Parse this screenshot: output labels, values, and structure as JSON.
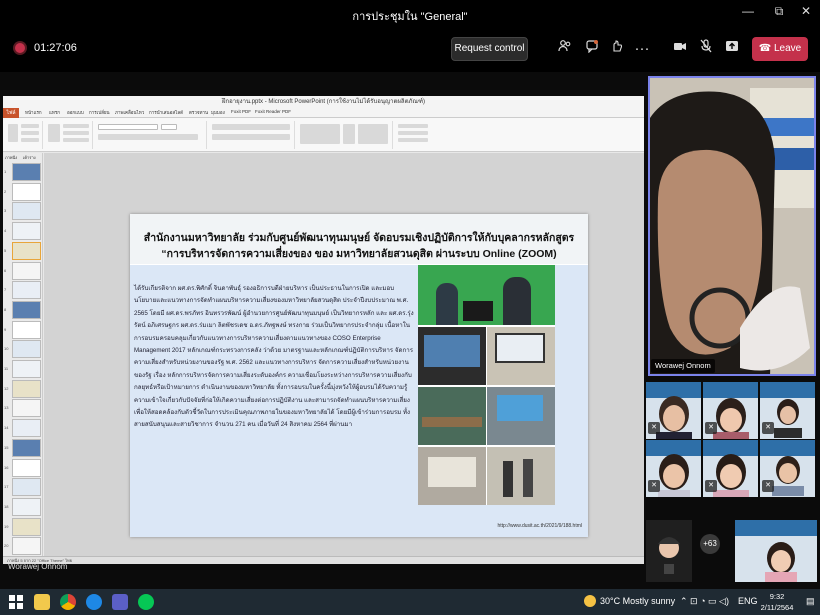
{
  "window": {
    "title": "การประชุมใน \"General\"",
    "minimize": "—",
    "maximize": "⧉",
    "close": "✕"
  },
  "toolbar": {
    "timer": "01:27:06",
    "request_control": "Request control",
    "leave": "Leave"
  },
  "presentation": {
    "app_title": "ฝึกอายุงาน.pptx - Microsoft PowerPoint (การใช้งานไม่ได้รับอนุญาตผลิตภัณฑ์)",
    "file_tab": "ไฟล์",
    "tabs": [
      "หน้าแรก",
      "แทรก",
      "ออกแบบ",
      "การเปลี่ยน",
      "ภาพเคลื่อนไหว",
      "การนำเสนอสไลด์",
      "ตรวจทาน",
      "มุมมอง",
      "Foxit PDF",
      "Foxit Reader PDF"
    ],
    "panel_tabs": [
      "ภาพนิ่ง",
      "เค้าร่าง"
    ],
    "slide_count": 22,
    "selected_slide": 5,
    "status": "ภาพนิ่ง 5 จาก 22   \"Office Theme\"   ไทย",
    "slide": {
      "title_line1": "สำนักงานมหาวิทยาลัย ร่วมกับศูนย์พัฒนาทุนมนุษย์ จัดอบรมเชิงปฏิบัติการให้กับบุคลากรหลักสูตร",
      "title_line2": "“การบริหารจัดการความเสี่ยงของ ของ มหาวิทยาลัยสวนดุสิต ผ่านระบบ Online (ZOOM)",
      "body": "ได้รับเกียรติจาก ผศ.ดร.พิศักดิ์ จินดาพันธ์ุ รองอธิการบดีฝ่ายบริหาร เป็นประธานในการเปิด และมอบนโยบายและแนวทางการจัดทำแผนบริหารความเสี่ยงของมหาวิทยาลัยสวนดุสิต ประจำปีงบประมาณ พ.ศ. 2565 โดยมี ผศ.ดร.พรภัทร อินทรวรพัฒน์ ผู้อำนวยการศูนย์พัฒนาทุนมนุษย์ เป็นวิทยากรหลัก และ ผศ.ดร.รุ่งรัตน์ อภิเศรษฐกร ผศ.ดร.ร่มเมา ลิตพัชรเดช อ.ดร.ภัทฐพงษ์ ทรงกาย ร่วมเป็นวิทยากรประจำกลุ่ม เนื้อหาในการอบรมครอบคลุมเกี่ยวกับแนวทางการบริหารความเสี่ยงตามแนวทางของ COSO Enterprise Management 2017 หลักเกณฑ์กระทรวงการคลัง ว่าด้วย มาตรฐานและหลักเกณฑ์ปฏิบัติการบริหาร จัดการความเสี่ยงสำหรับหน่วยงานของรัฐ พ.ศ. 2562 และแนวทางการบริหาร จัดการความเสี่ยงสำหรับหน่วยงานของรัฐ เรื่อง หลักการบริหารจัดการความเสี่ยงระดับองค์กร ความเชื่อมโยงระหว่างการบริหารความเสี่ยงกับกลยุทธ์หรือเป้าหมายการ ดำเนินงานของมหาวิทยาลัย ทั้งการอบรมในครั้งนี้มุ่งหวังให้ผู้อบรมได้รับความรู้ความเข้าใจเกี่ยวกับปัจจัยที่ก่อให้เกิดความเสี่ยงต่อการปฏิบัติงาน และสามารถจัดทำแผนบริหารความเสี่ยง เพื่อให้สอดคล้องกับตัวชี้วัดในการประเมินคุณภาพภายในของมหาวิทยาลัยได้ โดยมีผู้เข้าร่วมการอบรม ทั้งสายสนับสนุนและสายวิชาการ จำนวน 271 คน เมื่อวันที่ 24 สิงหาคม 2564 ที่ผ่านมา",
      "url": "http://www.dusit.ac.th/2021/9/188.html"
    }
  },
  "presenter_name": "Worawej Onnom",
  "main_video_name": "Worawej Onnom",
  "participants_overflow": "+63",
  "taskbar": {
    "weather": "30°C  Mostly sunny",
    "lang": "ENG",
    "time": "9:32",
    "date": "2/11/2564"
  },
  "colors": {
    "leave": "#c4314b",
    "accent": "#7b83eb",
    "ppt_file_tab": "#c8532b"
  }
}
